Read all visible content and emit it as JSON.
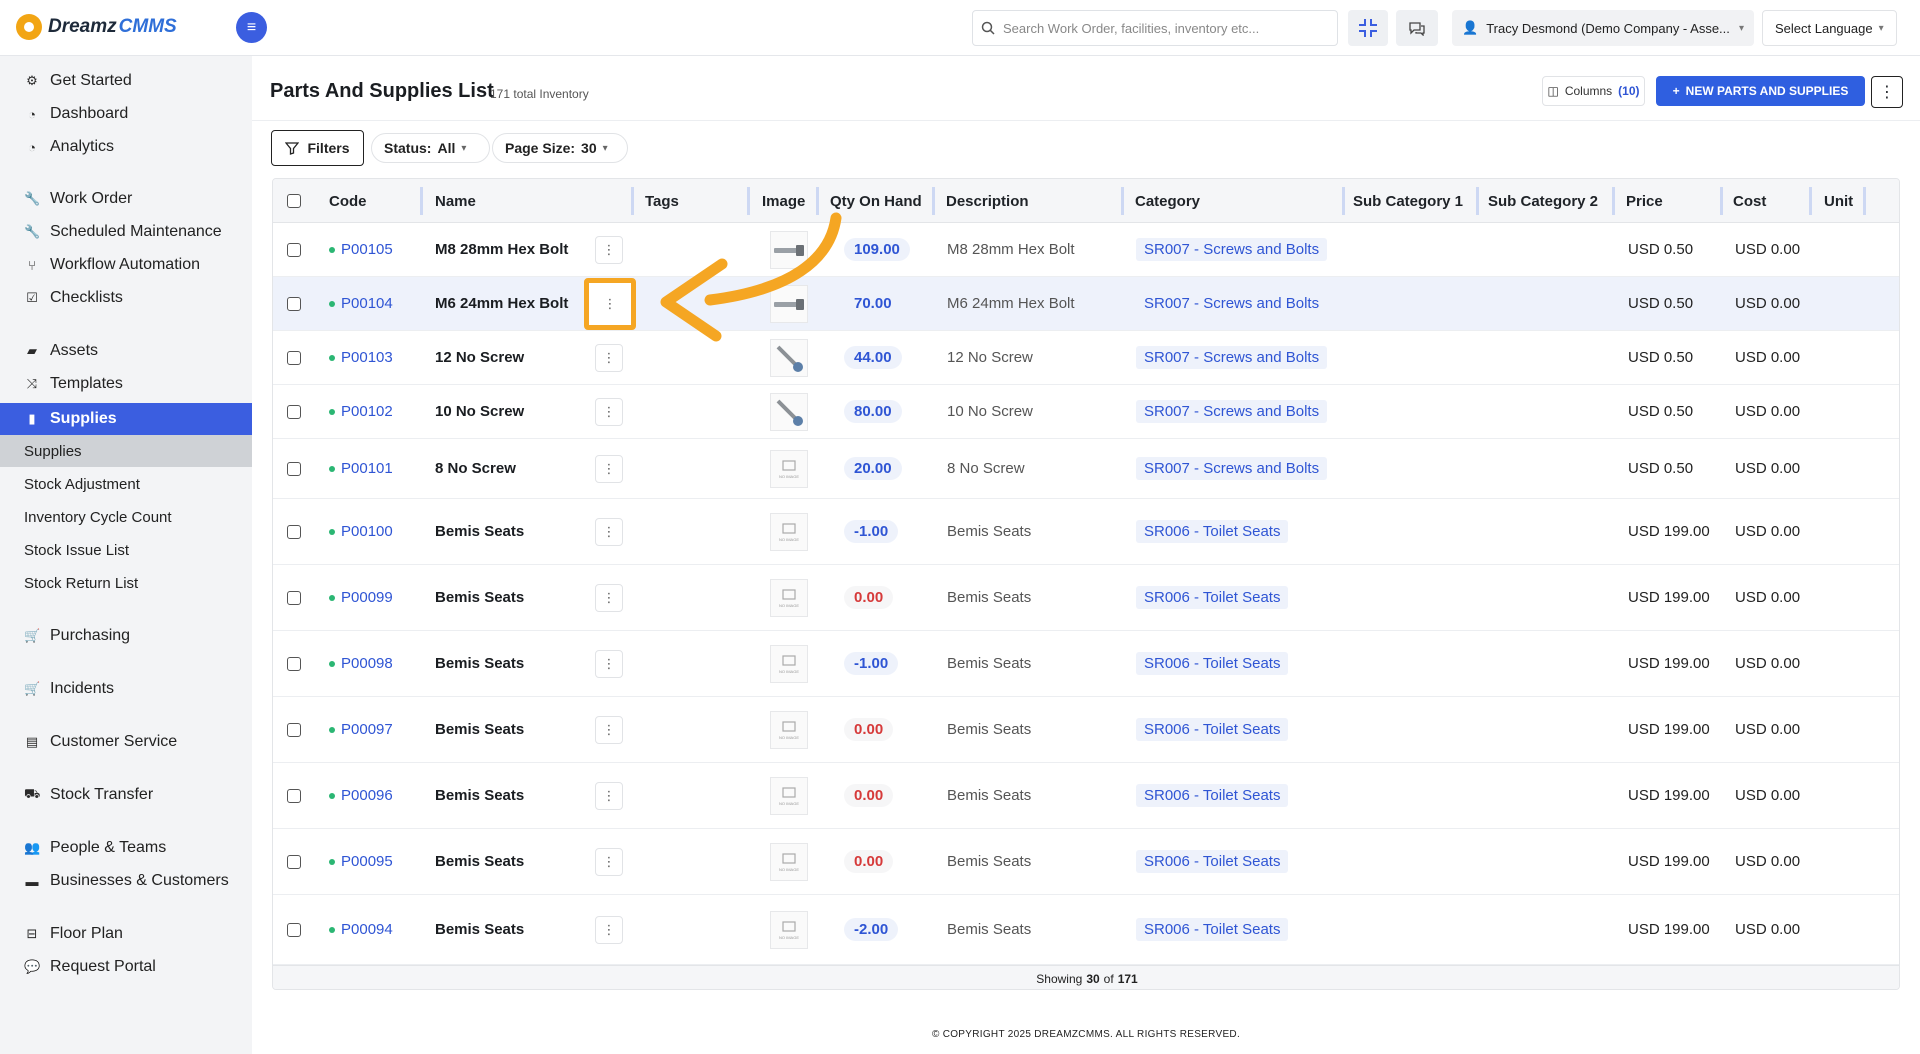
{
  "app": {
    "logo_part1": "Dreamz",
    "logo_part2": "CMMS"
  },
  "topbar": {
    "search_placeholder": "Search Work Order, facilities, inventory etc...",
    "user_label": "Tracy Desmond (Demo Company - Asse...",
    "language_label": "Select Language"
  },
  "sidebar": {
    "items": [
      {
        "label": "Get Started",
        "icon": "gears-icon"
      },
      {
        "label": "Dashboard",
        "icon": "dashboard-icon"
      },
      {
        "label": "Analytics",
        "icon": "analytics-icon"
      },
      {
        "label": "Work Order",
        "icon": "wrench-icon"
      },
      {
        "label": "Scheduled Maintenance",
        "icon": "wrench-icon"
      },
      {
        "label": "Workflow Automation",
        "icon": "flow-icon"
      },
      {
        "label": "Checklists",
        "icon": "checklist-icon"
      },
      {
        "label": "Assets",
        "icon": "assets-icon"
      },
      {
        "label": "Templates",
        "icon": "shuffle-icon"
      },
      {
        "label": "Supplies",
        "icon": "supplies-icon"
      },
      {
        "label": "Purchasing",
        "icon": "cart-icon"
      },
      {
        "label": "Incidents",
        "icon": "cart-icon"
      },
      {
        "label": "Customer Service",
        "icon": "document-icon"
      },
      {
        "label": "Stock Transfer",
        "icon": "truck-icon"
      },
      {
        "label": "People & Teams",
        "icon": "people-icon"
      },
      {
        "label": "Businesses & Customers",
        "icon": "briefcase-icon"
      },
      {
        "label": "Floor Plan",
        "icon": "floorplan-icon"
      },
      {
        "label": "Request Portal",
        "icon": "chat-icon"
      }
    ],
    "sub_items": [
      "Supplies",
      "Stock Adjustment",
      "Inventory Cycle Count",
      "Stock Issue List",
      "Stock Return List"
    ]
  },
  "page": {
    "title": "Parts And Supplies List",
    "subtitle": "171 total Inventory",
    "columns_label": "Columns",
    "columns_count": "(10)",
    "new_button": "NEW PARTS AND SUPPLIES",
    "filters_label": "Filters",
    "status_label": "Status:",
    "status_value": "All",
    "pagesize_label": "Page Size:",
    "pagesize_value": "30"
  },
  "table": {
    "headers": [
      "Code",
      "Name",
      "Tags",
      "Image",
      "Qty On Hand",
      "Description",
      "Category",
      "Sub Category 1",
      "Sub Category 2",
      "Price",
      "Cost",
      "Unit"
    ],
    "rows": [
      {
        "code": "P00105",
        "name": "M8 28mm Hex Bolt",
        "image": "bolt",
        "qty": "109.00",
        "qty_state": "pos",
        "description": "M8 28mm Hex Bolt",
        "category": "SR007 - Screws and Bolts",
        "price": "USD 0.50",
        "cost": "USD 0.00"
      },
      {
        "code": "P00104",
        "name": "M6 24mm Hex Bolt",
        "image": "bolt",
        "qty": "70.00",
        "qty_state": "pos",
        "description": "M6 24mm Hex Bolt",
        "category": "SR007 - Screws and Bolts",
        "price": "USD 0.50",
        "cost": "USD 0.00"
      },
      {
        "code": "P00103",
        "name": "12 No Screw",
        "image": "screw",
        "qty": "44.00",
        "qty_state": "pos",
        "description": "12 No Screw",
        "category": "SR007 - Screws and Bolts",
        "price": "USD 0.50",
        "cost": "USD 0.00"
      },
      {
        "code": "P00102",
        "name": "10 No Screw",
        "image": "screw",
        "qty": "80.00",
        "qty_state": "pos",
        "description": "10 No Screw",
        "category": "SR007 - Screws and Bolts",
        "price": "USD 0.50",
        "cost": "USD 0.00"
      },
      {
        "code": "P00101",
        "name": "8 No Screw",
        "image": "noimage",
        "qty": "20.00",
        "qty_state": "pos",
        "description": "8 No Screw",
        "category": "SR007 - Screws and Bolts",
        "price": "USD 0.50",
        "cost": "USD 0.00"
      },
      {
        "code": "P00100",
        "name": "Bemis Seats",
        "image": "noimage",
        "qty": "-1.00",
        "qty_state": "neg",
        "description": "Bemis Seats",
        "category": "SR006 - Toilet Seats",
        "price": "USD 199.00",
        "cost": "USD 0.00"
      },
      {
        "code": "P00099",
        "name": "Bemis Seats",
        "image": "noimage",
        "qty": "0.00",
        "qty_state": "zero",
        "description": "Bemis Seats",
        "category": "SR006 - Toilet Seats",
        "price": "USD 199.00",
        "cost": "USD 0.00"
      },
      {
        "code": "P00098",
        "name": "Bemis Seats",
        "image": "noimage",
        "qty": "-1.00",
        "qty_state": "neg",
        "description": "Bemis Seats",
        "category": "SR006 - Toilet Seats",
        "price": "USD 199.00",
        "cost": "USD 0.00"
      },
      {
        "code": "P00097",
        "name": "Bemis Seats",
        "image": "noimage",
        "qty": "0.00",
        "qty_state": "zero",
        "description": "Bemis Seats",
        "category": "SR006 - Toilet Seats",
        "price": "USD 199.00",
        "cost": "USD 0.00"
      },
      {
        "code": "P00096",
        "name": "Bemis Seats",
        "image": "noimage",
        "qty": "0.00",
        "qty_state": "zero",
        "description": "Bemis Seats",
        "category": "SR006 - Toilet Seats",
        "price": "USD 199.00",
        "cost": "USD 0.00"
      },
      {
        "code": "P00095",
        "name": "Bemis Seats",
        "image": "noimage",
        "qty": "0.00",
        "qty_state": "zero",
        "description": "Bemis Seats",
        "category": "SR006 - Toilet Seats",
        "price": "USD 199.00",
        "cost": "USD 0.00"
      },
      {
        "code": "P00094",
        "name": "Bemis Seats",
        "image": "noimage",
        "qty": "-2.00",
        "qty_state": "neg",
        "description": "Bemis Seats",
        "category": "SR006 - Toilet Seats",
        "price": "USD 199.00",
        "cost": "USD 0.00"
      }
    ],
    "footer_prefix": "Showing",
    "footer_shown": "30",
    "footer_of": "of",
    "footer_total": "171"
  },
  "footer": {
    "copyright": "© COPYRIGHT 2025 DREAMZCMMS. ALL RIGHTS RESERVED."
  },
  "colors": {
    "accent": "#3b5ee0",
    "highlight": "#f5a623",
    "positive": "#2bb673",
    "negative": "#d63a3a"
  }
}
